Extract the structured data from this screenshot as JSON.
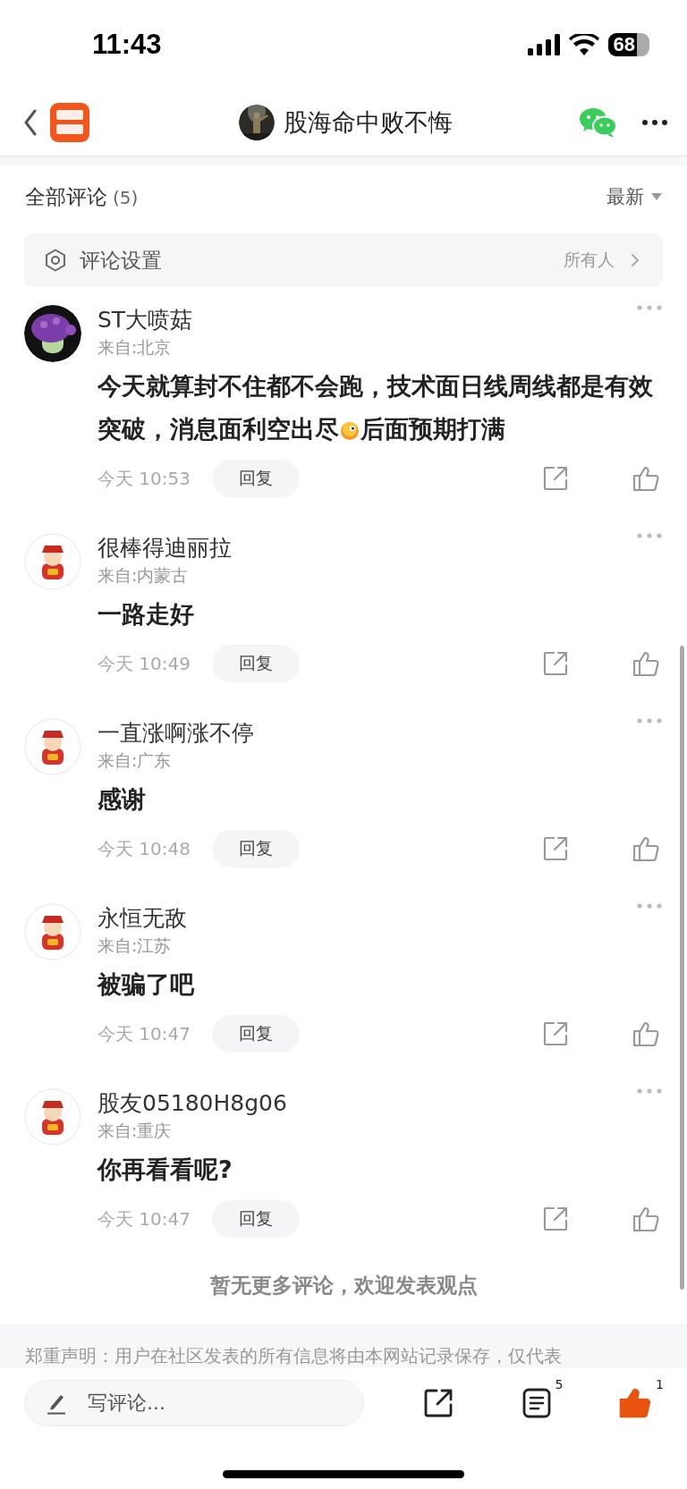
{
  "status_bar": {
    "time": "11:43",
    "battery": "68"
  },
  "nav": {
    "title": "股海命中败不悔"
  },
  "comments_header": {
    "title": "全部评论",
    "count": "(5)",
    "sort": "最新"
  },
  "settings_row": {
    "label": "评论设置",
    "value": "所有人"
  },
  "comments": [
    {
      "kind": "mushroom",
      "name": "ST大喷菇",
      "location": "来自:北京",
      "text_parts": [
        "今天就算封不住都不会跑，技术面日线周线都是有效突破，消息面利空出尽",
        "后面预期打满"
      ],
      "time": "今天 10:53",
      "reply": "回复",
      "liked": false
    },
    {
      "kind": "figure",
      "name": "很棒得迪丽拉",
      "location": "来自:内蒙古",
      "text_parts": [
        "一路走好"
      ],
      "time": "今天 10:49",
      "reply": "回复",
      "liked": false
    },
    {
      "kind": "figure",
      "name": "一直涨啊涨不停",
      "location": "来自:广东",
      "text_parts": [
        "感谢"
      ],
      "time": "今天 10:48",
      "reply": "回复",
      "liked": false
    },
    {
      "kind": "figure",
      "name": "永恒无敌",
      "location": "来自:江苏",
      "text_parts": [
        "被骗了吧"
      ],
      "time": "今天 10:47",
      "reply": "回复",
      "liked": false
    },
    {
      "kind": "figure",
      "name": "股友05180H8g06",
      "location": "来自:重庆",
      "text_parts": [
        "你再看看呢?"
      ],
      "time": "今天 10:47",
      "reply": "回复",
      "liked": false
    }
  ],
  "end_note": "暂无更多评论，欢迎发表观点",
  "disclaimer": "郑重声明：用户在社区发表的所有信息将由本网站记录保存，仅代表",
  "bottom_bar": {
    "placeholder": "写评论...",
    "comment_count": "5",
    "like_count": "1",
    "liked": true
  }
}
